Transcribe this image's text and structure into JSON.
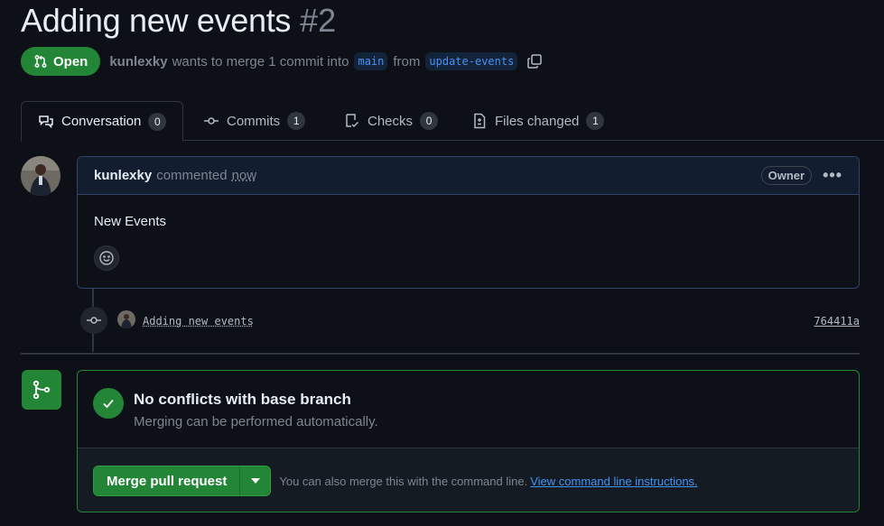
{
  "pr": {
    "title": "Adding new events",
    "number": "#2",
    "state": "Open",
    "author": "kunlexky",
    "wants_to_merge": "wants to merge 1 commit into",
    "base_branch": "main",
    "from": "from",
    "head_branch": "update-events"
  },
  "tabs": [
    {
      "label": "Conversation",
      "count": "0",
      "icon": "comment-discussion-icon"
    },
    {
      "label": "Commits",
      "count": "1",
      "icon": "git-commit-icon"
    },
    {
      "label": "Checks",
      "count": "0",
      "icon": "checklist-icon"
    },
    {
      "label": "Files changed",
      "count": "1",
      "icon": "file-diff-icon"
    }
  ],
  "comment": {
    "author": "kunlexky",
    "action": "commented",
    "time": "now",
    "role_badge": "Owner",
    "body": "New Events"
  },
  "commit": {
    "message": "Adding new events",
    "sha": "764411a"
  },
  "merge": {
    "status_title": "No conflicts with base branch",
    "status_subtitle": "Merging can be performed automatically.",
    "button_label": "Merge pull request",
    "hint": "You can also merge this with the command line.",
    "link": "View command line instructions."
  },
  "colors": {
    "background": "#0d1117",
    "success": "#238636",
    "accent_link": "#4493f8",
    "muted_text": "#7d8590"
  }
}
